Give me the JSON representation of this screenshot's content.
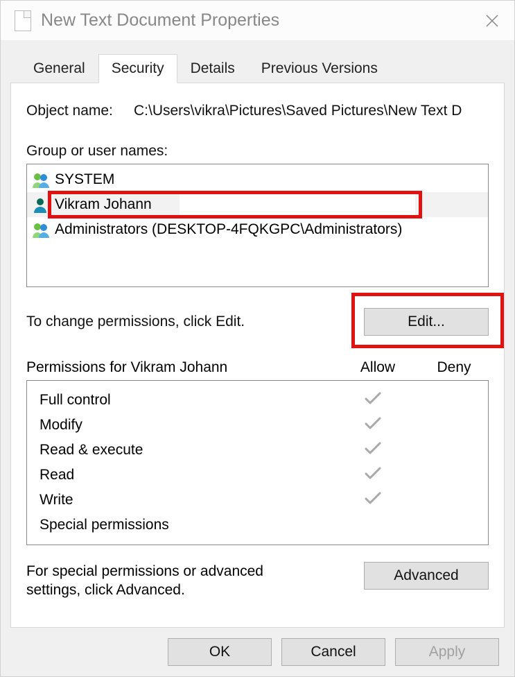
{
  "window": {
    "title": "New Text Document Properties"
  },
  "tabs": {
    "general": "General",
    "security": "Security",
    "details": "Details",
    "previous": "Previous Versions",
    "active": "security"
  },
  "security": {
    "object_name_label": "Object name:",
    "object_name_value": "C:\\Users\\vikra\\Pictures\\Saved Pictures\\New Text D",
    "group_label": "Group or user names:",
    "principals": [
      {
        "name": "SYSTEM",
        "icon": "group"
      },
      {
        "name": "Vikram Johann",
        "icon": "user",
        "selected": true,
        "highlighted": true
      },
      {
        "name": "Administrators (DESKTOP-4FQKGPC\\Administrators)",
        "icon": "group"
      }
    ],
    "change_text": "To change permissions, click Edit.",
    "edit_button": "Edit...",
    "perm_header": "Permissions for Vikram Johann",
    "allow_label": "Allow",
    "deny_label": "Deny",
    "permissions": [
      {
        "name": "Full control",
        "allow": true,
        "deny": false
      },
      {
        "name": "Modify",
        "allow": true,
        "deny": false
      },
      {
        "name": "Read & execute",
        "allow": true,
        "deny": false
      },
      {
        "name": "Read",
        "allow": true,
        "deny": false
      },
      {
        "name": "Write",
        "allow": true,
        "deny": false
      },
      {
        "name": "Special permissions",
        "allow": false,
        "deny": false
      }
    ],
    "advanced_text": "For special permissions or advanced settings, click Advanced.",
    "advanced_button": "Advanced"
  },
  "footer": {
    "ok": "OK",
    "cancel": "Cancel",
    "apply": "Apply"
  },
  "highlights": {
    "user_box": {
      "enabled": true
    },
    "edit_box": {
      "enabled": true
    }
  }
}
